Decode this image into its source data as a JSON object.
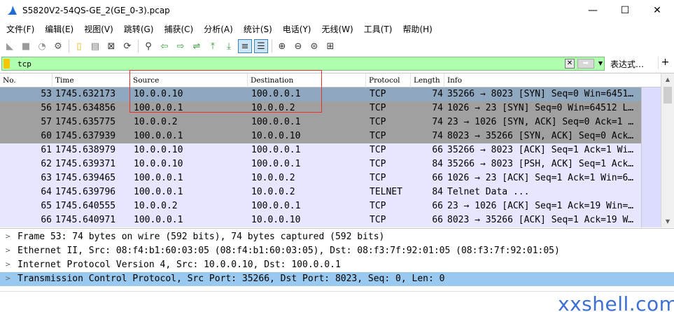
{
  "window": {
    "title": "S5820V2-54QS-GE_2(GE_0-3).pcap",
    "minimize": "—",
    "maximize": "☐",
    "close": "✕"
  },
  "menu": [
    "文件(F)",
    "编辑(E)",
    "视图(V)",
    "跳转(G)",
    "捕获(C)",
    "分析(A)",
    "统计(S)",
    "电话(Y)",
    "无线(W)",
    "工具(T)",
    "帮助(H)"
  ],
  "toolbar": {
    "icons": [
      "shark-fin-icon",
      "stop-icon",
      "restart-icon",
      "options-icon",
      "open-icon",
      "save-icon",
      "close-file-icon",
      "reload-icon",
      "find-icon",
      "back-icon",
      "forward-icon",
      "goto-icon",
      "first-icon",
      "last-icon",
      "autoscroll-icon",
      "colorize-icon",
      "zoom-in-icon",
      "zoom-out-icon",
      "zoom-reset-icon",
      "resize-columns-icon"
    ]
  },
  "filter": {
    "value": "tcp",
    "expression_label": "表达式…",
    "add_label": "+"
  },
  "columns": [
    "No.",
    "Time",
    "Source",
    "Destination",
    "Protocol",
    "Length",
    "Info"
  ],
  "packets": [
    {
      "no": "53",
      "time": "1745.632173",
      "src": "10.0.0.10",
      "dst": "100.0.0.1",
      "proto": "TCP",
      "len": "74",
      "info": "35266 → 8023 [SYN] Seq=0 Win=6451…",
      "style": "sel"
    },
    {
      "no": "56",
      "time": "1745.634856",
      "src": "100.0.0.1",
      "dst": "10.0.0.2",
      "proto": "TCP",
      "len": "74",
      "info": "1026 → 23 [SYN] Seq=0 Win=64512 L…",
      "style": "syn"
    },
    {
      "no": "57",
      "time": "1745.635775",
      "src": "10.0.0.2",
      "dst": "100.0.0.1",
      "proto": "TCP",
      "len": "74",
      "info": "23 → 1026 [SYN, ACK] Seq=0 Ack=1 …",
      "style": "syn"
    },
    {
      "no": "60",
      "time": "1745.637939",
      "src": "100.0.0.1",
      "dst": "10.0.0.10",
      "proto": "TCP",
      "len": "74",
      "info": "8023 → 35266 [SYN, ACK] Seq=0 Ack…",
      "style": "syn"
    },
    {
      "no": "61",
      "time": "1745.638979",
      "src": "10.0.0.10",
      "dst": "100.0.0.1",
      "proto": "TCP",
      "len": "66",
      "info": "35266 → 8023 [ACK] Seq=1 Ack=1 Wi…",
      "style": "norm"
    },
    {
      "no": "62",
      "time": "1745.639371",
      "src": "10.0.0.10",
      "dst": "100.0.0.1",
      "proto": "TCP",
      "len": "84",
      "info": "35266 → 8023 [PSH, ACK] Seq=1 Ack…",
      "style": "norm"
    },
    {
      "no": "63",
      "time": "1745.639465",
      "src": "100.0.0.1",
      "dst": "10.0.0.2",
      "proto": "TCP",
      "len": "66",
      "info": "1026 → 23 [ACK] Seq=1 Ack=1 Win=6…",
      "style": "norm"
    },
    {
      "no": "64",
      "time": "1745.639796",
      "src": "100.0.0.1",
      "dst": "10.0.0.2",
      "proto": "TELNET",
      "len": "84",
      "info": "Telnet Data ...",
      "style": "norm"
    },
    {
      "no": "65",
      "time": "1745.640555",
      "src": "10.0.0.2",
      "dst": "100.0.0.1",
      "proto": "TCP",
      "len": "66",
      "info": "23 → 1026 [ACK] Seq=1 Ack=19 Win=…",
      "style": "norm"
    },
    {
      "no": "66",
      "time": "1745.640971",
      "src": "100.0.0.1",
      "dst": "10.0.0.10",
      "proto": "TCP",
      "len": "66",
      "info": "8023 → 35266 [ACK] Seq=1 Ack=19 W…",
      "style": "norm"
    }
  ],
  "details": [
    {
      "text": "Frame 53: 74 bytes on wire (592 bits), 74 bytes captured (592 bits)",
      "selected": false
    },
    {
      "text": "Ethernet II, Src: 08:f4:b1:60:03:05 (08:f4:b1:60:03:05), Dst: 08:f3:7f:92:01:05 (08:f3:7f:92:01:05)",
      "selected": false
    },
    {
      "text": "Internet Protocol Version 4, Src: 10.0.0.10, Dst: 100.0.0.1",
      "selected": false
    },
    {
      "text": "Transmission Control Protocol, Src Port: 35266, Dst Port: 8023, Seq: 0, Len: 0",
      "selected": true
    }
  ],
  "watermark": "xxshell.com",
  "colors": {
    "filter_bg": "#afffaf",
    "selected_row": "#8fa8c0",
    "syn_row": "#a0a0a0",
    "normal_row": "#e7e6ff",
    "detail_selected": "#99c9ef",
    "highlight_border": "#e83030"
  }
}
